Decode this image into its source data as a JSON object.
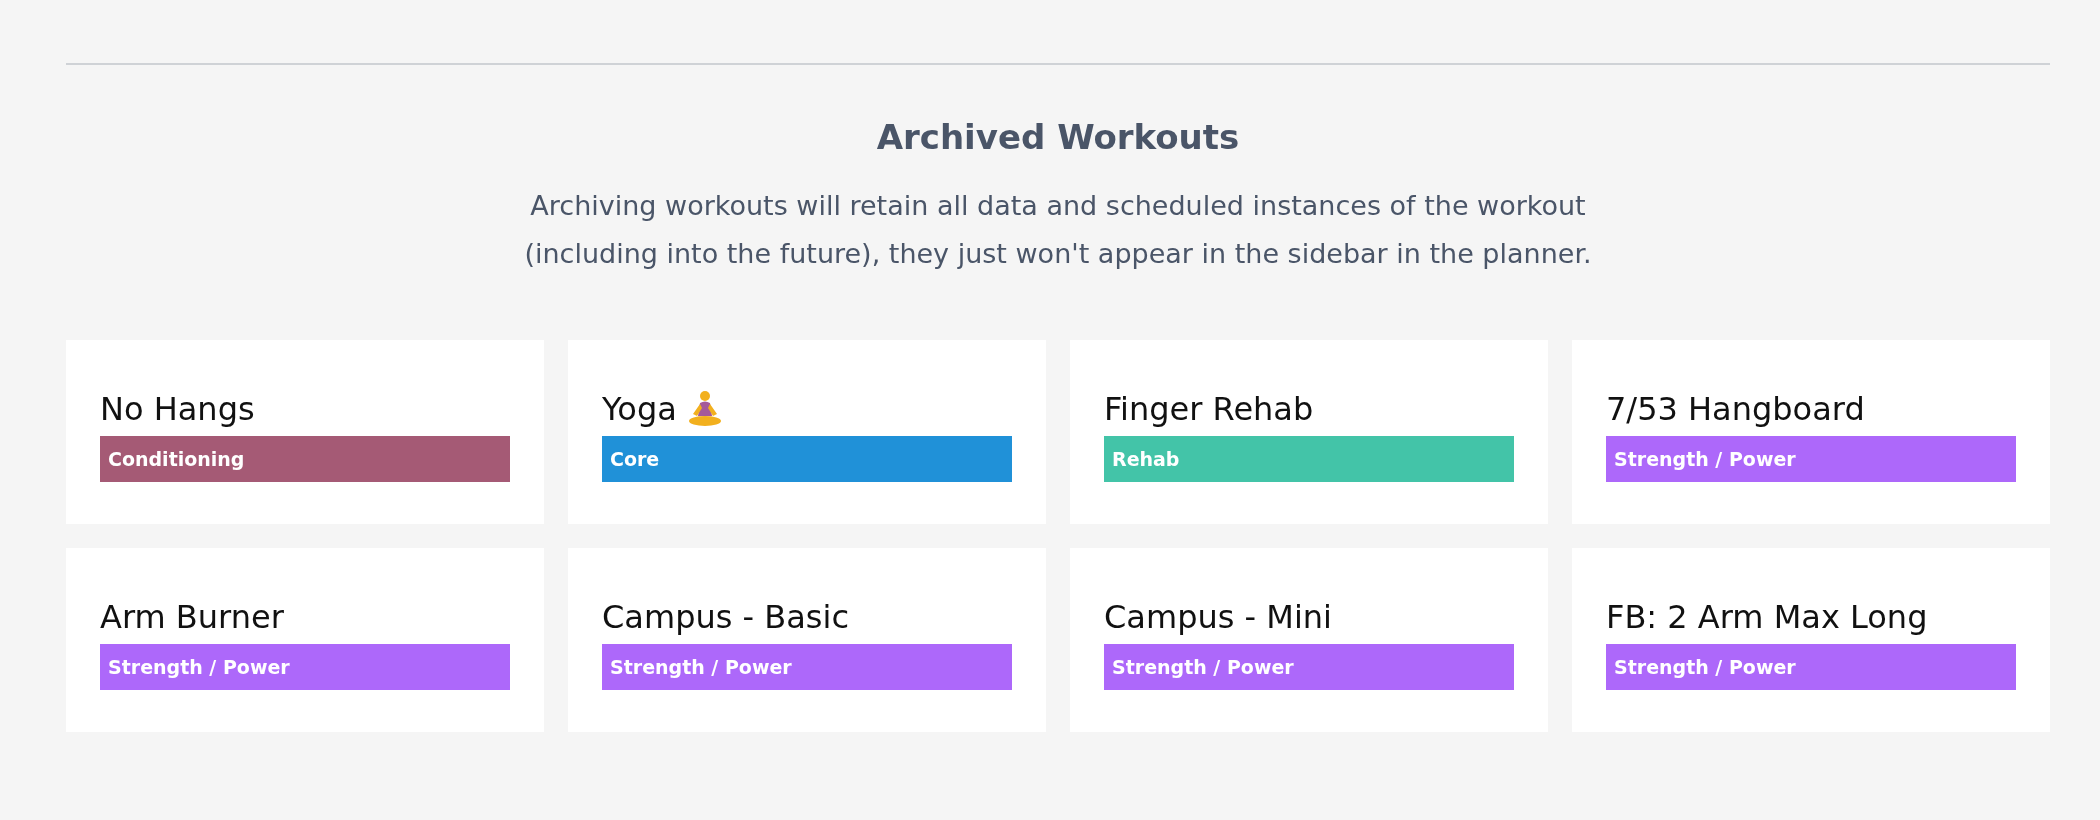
{
  "title": "Archived Workouts",
  "description": "Archiving workouts will retain all data and scheduled instances of the workout (including into the future), they just won't appear in the sidebar in the planner.",
  "workouts": [
    {
      "name": "No Hangs",
      "kind": "plain",
      "tag": "Conditioning",
      "color": "#a55a75"
    },
    {
      "name": "Yoga",
      "kind": "with-icon",
      "tag": "Core",
      "color": "#2091d8"
    },
    {
      "name": "Finger Rehab",
      "kind": "plain",
      "tag": "Rehab",
      "color": "#43c4a8"
    },
    {
      "name": "7/53 Hangboard",
      "kind": "plain",
      "tag": "Strength / Power",
      "color": "#ad68fa"
    },
    {
      "name": "Arm Burner",
      "kind": "plain",
      "tag": "Strength / Power",
      "color": "#ad68fa"
    },
    {
      "name": "Campus - Basic",
      "kind": "plain",
      "tag": "Strength / Power",
      "color": "#ad68fa"
    },
    {
      "name": "Campus - Mini",
      "kind": "plain",
      "tag": "Strength / Power",
      "color": "#ad68fa"
    },
    {
      "name": "FB: 2 Arm Max Long",
      "kind": "plain",
      "tag": "Strength / Power",
      "color": "#ad68fa"
    }
  ]
}
